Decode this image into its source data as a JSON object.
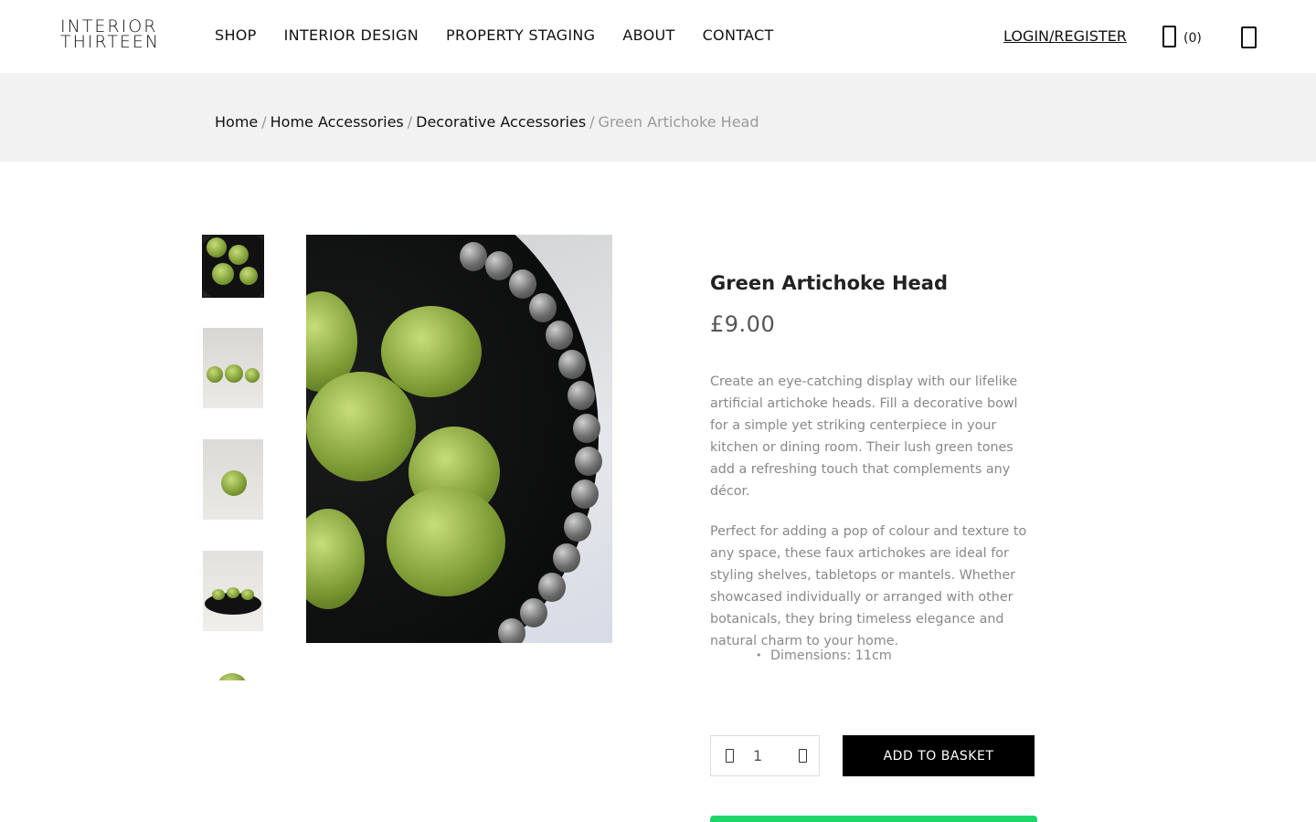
{
  "header": {
    "logo_line1": "INTERIOR",
    "logo_line2": "THIRTEEN",
    "nav": [
      "SHOP",
      "INTERIOR DESIGN",
      "PROPERTY STAGING",
      "ABOUT",
      "CONTACT"
    ],
    "login_label": "LOGIN/REGISTER",
    "cart_count": "(0)",
    "cart_icon": "shopping-bag-icon",
    "menu_icon": "menu-icon"
  },
  "breadcrumb": {
    "items": [
      "Home",
      "Home Accessories",
      "Decorative Accessories"
    ],
    "current": "Green Artichoke Head",
    "separator": "/"
  },
  "gallery": {
    "thumbnail_count": 5,
    "active_index": 0
  },
  "product": {
    "title": "Green Artichoke Head",
    "price": "£9.00",
    "description": [
      "Create an eye-catching display with our lifelike artificial artichoke heads. Fill a decorative bowl for a simple yet striking centerpiece in your kitchen or dining room. Their lush green tones add a refreshing touch that complements any décor.",
      "Perfect for adding a pop of colour and texture to any space, these faux artichokes are ideal for styling shelves, tabletops or mantels. Whether showcased individually or arranged with other botanicals, they bring timeless elegance and natural charm to your home."
    ],
    "specs": [
      "Dimensions: 11cm"
    ]
  },
  "purchase": {
    "quantity": "1",
    "add_label": "ADD TO BASKET",
    "accent_color": "#1ed56a"
  }
}
